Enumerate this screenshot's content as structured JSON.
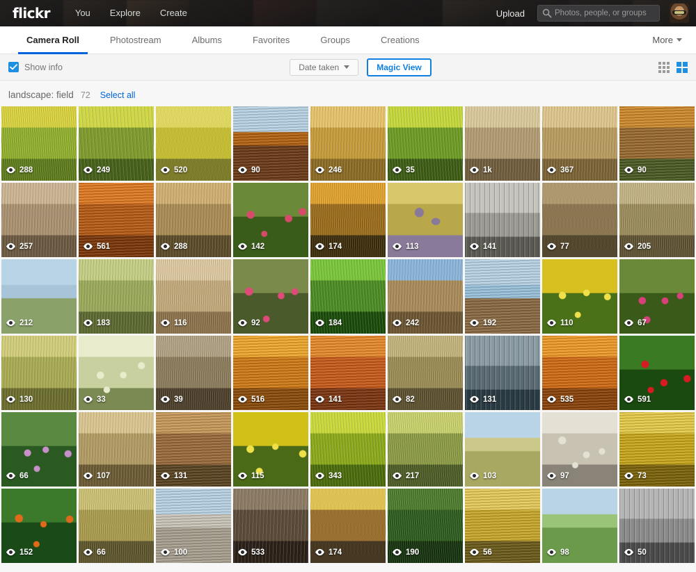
{
  "header": {
    "logo": "flickr",
    "nav": [
      {
        "label": "You",
        "name": "nav-you"
      },
      {
        "label": "Explore",
        "name": "nav-explore"
      },
      {
        "label": "Create",
        "name": "nav-create"
      }
    ],
    "upload_label": "Upload",
    "search": {
      "placeholder": "Photos, people, or groups",
      "value": "",
      "icon": "search-icon"
    },
    "avatar_name": "user-avatar",
    "colors": {
      "background": "#1c1c1e",
      "text": "#d8d8d8"
    }
  },
  "tabs": {
    "items": [
      {
        "label": "Camera Roll",
        "active": true
      },
      {
        "label": "Photostream",
        "active": false
      },
      {
        "label": "Albums",
        "active": false
      },
      {
        "label": "Favorites",
        "active": false
      },
      {
        "label": "Groups",
        "active": false
      },
      {
        "label": "Creations",
        "active": false
      }
    ],
    "more_label": "More",
    "active_color": "#0063dc"
  },
  "toolbar": {
    "show_info_label": "Show info",
    "show_info_checked": true,
    "sort_label": "Date taken",
    "magic_view_label": "Magic View",
    "magic_view_active": true,
    "view_small_icon": "small-grid-icon",
    "view_large_icon": "large-grid-icon",
    "view_mode": "large",
    "accent_color": "#0f7fe0"
  },
  "section": {
    "title": "landscape: field",
    "count": "72",
    "select_all_label": "Select all"
  },
  "grid": {
    "columns": 9,
    "view_icon": "eye-icon",
    "photos": [
      {
        "views": "288",
        "c1": "#8fae2a",
        "c2": "#d8d23c",
        "c3": "#5c7a18",
        "kind": "field"
      },
      {
        "views": "249",
        "c1": "#7f9a2c",
        "c2": "#cfd645",
        "c3": "#46601a",
        "kind": "field"
      },
      {
        "views": "520",
        "c1": "#c9c227",
        "c2": "#e8e05a",
        "c3": "#7a7a1c",
        "kind": "field"
      },
      {
        "views": "90",
        "c1": "#6b3a16",
        "c2": "#b4620f",
        "c3": "#1a0c04",
        "kind": "soil"
      },
      {
        "views": "246",
        "c1": "#c59a3a",
        "c2": "#e3c26a",
        "c3": "#8a6a22",
        "kind": "wheat"
      },
      {
        "views": "35",
        "c1": "#6d9a22",
        "c2": "#c4d63a",
        "c3": "#3b5c12",
        "kind": "field"
      },
      {
        "views": "1k",
        "c1": "#b09a72",
        "c2": "#d8c89c",
        "c3": "#6e5c3c",
        "kind": "grass"
      },
      {
        "views": "367",
        "c1": "#b79a5e",
        "c2": "#dcc48a",
        "c3": "#7a6234",
        "kind": "wheat"
      },
      {
        "views": "90",
        "c1": "#9a6a2e",
        "c2": "#cf8a2a",
        "c3": "#4a5a22",
        "kind": "autumn"
      },
      {
        "views": "257",
        "c1": "#a89070",
        "c2": "#c9b392",
        "c3": "#6a5840",
        "kind": "grass"
      },
      {
        "views": "561",
        "c1": "#b85a14",
        "c2": "#e07a22",
        "c3": "#7a3608",
        "kind": "autumn"
      },
      {
        "views": "288",
        "c1": "#a88a52",
        "c2": "#cfae72",
        "c3": "#5a4a28",
        "kind": "wheat"
      },
      {
        "views": "142",
        "c1": "#6a8a3a",
        "c2": "#d84a6a",
        "c3": "#3a5c1a",
        "kind": "tulip"
      },
      {
        "views": "174",
        "c1": "#9a6a18",
        "c2": "#e0a02a",
        "c3": "#3a2a08",
        "kind": "wheat"
      },
      {
        "views": "113",
        "c1": "#b8a84a",
        "c2": "#d8c86a",
        "c3": "#8a7a9a",
        "kind": "thistle"
      },
      {
        "views": "141",
        "c1": "#9a9a92",
        "c2": "#c4c4bc",
        "c3": "#5a5a52",
        "kind": "winter"
      },
      {
        "views": "77",
        "c1": "#8a7248",
        "c2": "#b09a6a",
        "c3": "#4a3c20",
        "kind": "wheat"
      },
      {
        "views": "205",
        "c1": "#9a8a5a",
        "c2": "#c2b283",
        "c3": "#5c5030",
        "kind": "grass"
      },
      {
        "views": "212",
        "c1": "#8aa26a",
        "c2": "#a8c4d8",
        "c3": "#5a7244",
        "kind": "meadow"
      },
      {
        "views": "183",
        "c1": "#9aa85a",
        "c2": "#c2cc82",
        "c3": "#5a6830",
        "kind": "grass"
      },
      {
        "views": "116",
        "c1": "#c2a87a",
        "c2": "#ddc79e",
        "c3": "#8a7048",
        "kind": "wheat"
      },
      {
        "views": "92",
        "c1": "#7a8a4a",
        "c2": "#e04a7a",
        "c3": "#4a5a2a",
        "kind": "tulip"
      },
      {
        "views": "184",
        "c1": "#4a8a22",
        "c2": "#7ac43a",
        "c3": "#1a4a0a",
        "kind": "field"
      },
      {
        "views": "242",
        "c1": "#a88a5a",
        "c2": "#8ab4d8",
        "c3": "#6a5430",
        "kind": "reeds"
      },
      {
        "views": "192",
        "c1": "#8a6a42",
        "c2": "#9ac2dc",
        "c3": "#5a4228",
        "kind": "soil"
      },
      {
        "views": "110",
        "c1": "#d8c020",
        "c2": "#f0e04a",
        "c3": "#4a7018",
        "kind": "tulip"
      },
      {
        "views": "67",
        "c1": "#6a8a3a",
        "c2": "#d8407a",
        "c3": "#3a5a1a",
        "kind": "tulip"
      },
      {
        "views": "130",
        "c1": "#a8aa52",
        "c2": "#d0cc7a",
        "c3": "#6a6c2c",
        "kind": "grass"
      },
      {
        "views": "33",
        "c1": "#c8d0a0",
        "c2": "#e8eccc",
        "c3": "#7a8a52",
        "kind": "flower"
      },
      {
        "views": "39",
        "c1": "#8a7a5a",
        "c2": "#b0a082",
        "c3": "#4a3c28",
        "kind": "reeds"
      },
      {
        "views": "516",
        "c1": "#d07a14",
        "c2": "#f0a82a",
        "c3": "#8a4a08",
        "kind": "autumn"
      },
      {
        "views": "141",
        "c1": "#c85a1a",
        "c2": "#e88a2a",
        "c3": "#7a3410",
        "kind": "autumn"
      },
      {
        "views": "82",
        "c1": "#9a8a52",
        "c2": "#c2b27a",
        "c3": "#5a4e2c",
        "kind": "reeds"
      },
      {
        "views": "131",
        "c1": "#5a6a72",
        "c2": "#8a9aa2",
        "c3": "#2a3a42",
        "kind": "winter"
      },
      {
        "views": "535",
        "c1": "#d06a12",
        "c2": "#f09a28",
        "c3": "#8a4208",
        "kind": "autumn"
      },
      {
        "views": "591",
        "c1": "#3a7a22",
        "c2": "#d81a22",
        "c3": "#1a4a10",
        "kind": "tulip"
      },
      {
        "views": "66",
        "c1": "#5a8a42",
        "c2": "#c890c8",
        "c3": "#2a5a22",
        "kind": "tulip"
      },
      {
        "views": "107",
        "c1": "#b09a62",
        "c2": "#d8c48e",
        "c3": "#6a5a32",
        "kind": "wheat"
      },
      {
        "views": "131",
        "c1": "#9a6a3a",
        "c2": "#c89a5a",
        "c3": "#5a4220",
        "kind": "autumn"
      },
      {
        "views": "115",
        "c1": "#d0c018",
        "c2": "#f0e048",
        "c3": "#4a6a18",
        "kind": "tulip"
      },
      {
        "views": "343",
        "c1": "#8aa81a",
        "c2": "#c8d83a",
        "c3": "#4a6a0a",
        "kind": "field"
      },
      {
        "views": "217",
        "c1": "#8a9a42",
        "c2": "#c8d06a",
        "c3": "#4a5a22",
        "kind": "field"
      },
      {
        "views": "103",
        "c1": "#a8a862",
        "c2": "#ccc88a",
        "c3": "#5a6a32",
        "kind": "meadow"
      },
      {
        "views": "97",
        "c1": "#c8c2b2",
        "c2": "#e4e0d4",
        "c3": "#8a8478",
        "kind": "flower"
      },
      {
        "views": "73",
        "c1": "#c8a81a",
        "c2": "#e8cc4a",
        "c3": "#7a6208",
        "kind": "autumn"
      },
      {
        "views": "152",
        "c1": "#3a7a2a",
        "c2": "#e06a1a",
        "c3": "#1a4a18",
        "kind": "tulip"
      },
      {
        "views": "66",
        "c1": "#a89a4a",
        "c2": "#ccc072",
        "c3": "#5a5228",
        "kind": "wheat"
      },
      {
        "views": "100",
        "c1": "#a8a090",
        "c2": "#ccc6ba",
        "c3": "#6a6458",
        "kind": "road"
      },
      {
        "views": "533",
        "c1": "#5a4a38",
        "c2": "#8a7a64",
        "c3": "#2a2018",
        "kind": "reeds"
      },
      {
        "views": "174",
        "c1": "#9a6a22",
        "c2": "#e8c84a",
        "c3": "#3a2a10",
        "kind": "wheat"
      },
      {
        "views": "190",
        "c1": "#2a5a1a",
        "c2": "#4a7a2a",
        "c3": "#12300a",
        "kind": "field"
      },
      {
        "views": "56",
        "c1": "#c8a82a",
        "c2": "#e8cc5a",
        "c3": "#6a5a18",
        "kind": "autumn"
      },
      {
        "views": "98",
        "c1": "#6a9a4a",
        "c2": "#9ac478",
        "c3": "#3a6a2a",
        "kind": "meadow"
      },
      {
        "views": "50",
        "c1": "#8a8a8a",
        "c2": "#b4b4b4",
        "c3": "#4a4a4a",
        "kind": "winter"
      }
    ]
  }
}
